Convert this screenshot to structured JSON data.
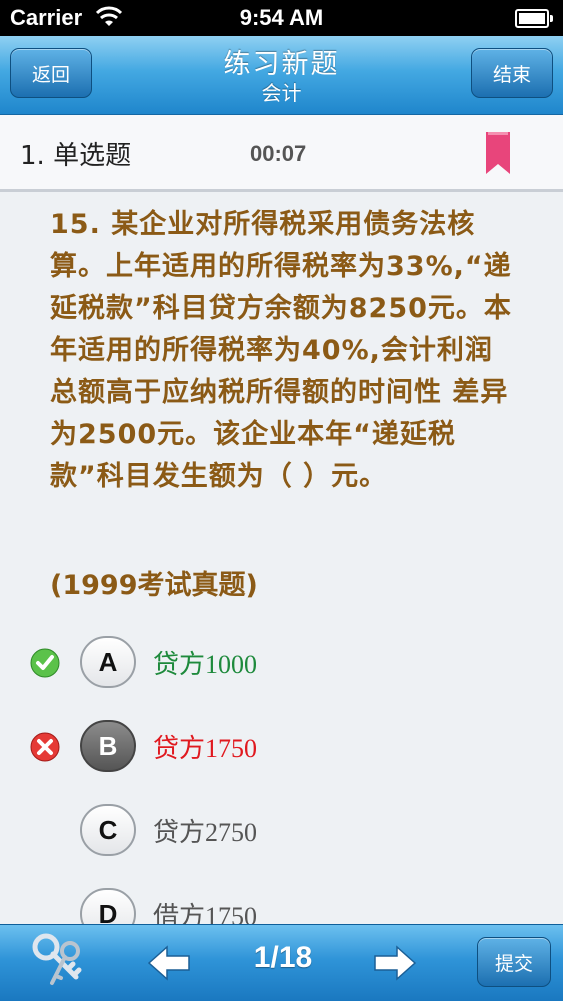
{
  "status_bar": {
    "carrier": "Carrier",
    "time": "9:54 AM"
  },
  "nav": {
    "title": "练习新题",
    "subtitle": "会计",
    "back_label": "返回",
    "end_label": "结束"
  },
  "question": {
    "type_label": "1. 单选题",
    "timer": "00:07",
    "text": "15. 某企业对所得税采用债务法核算。上年适用的所得税率为33%,“递延税款”科目贷方余额为8250元。本年适用的所得税率为40%,会计利润总额高于应纳税所得额的时间性 差异为2500元。该企业本年“递延税款”科目发生额为（ ）元。",
    "source": "(1999考试真题)"
  },
  "options": [
    {
      "letter": "A",
      "text": "贷方1000",
      "status": "correct"
    },
    {
      "letter": "B",
      "text": "贷方1750",
      "status": "wrong"
    },
    {
      "letter": "C",
      "text": "贷方2750",
      "status": "none"
    },
    {
      "letter": "D",
      "text": "借方1750",
      "status": "none"
    }
  ],
  "bottom_bar": {
    "page_indicator": "1/18",
    "submit_label": "提交"
  },
  "colors": {
    "question_text": "#8b5a16",
    "correct": "#1e8a3c",
    "wrong": "#e0191f",
    "bookmark": "#e8457b",
    "nav_blue": "#2f94d8"
  },
  "icons": {
    "bookmark": "bookmark-icon",
    "keys": "keys-icon",
    "prev": "arrow-left-icon",
    "next": "arrow-right-icon"
  }
}
